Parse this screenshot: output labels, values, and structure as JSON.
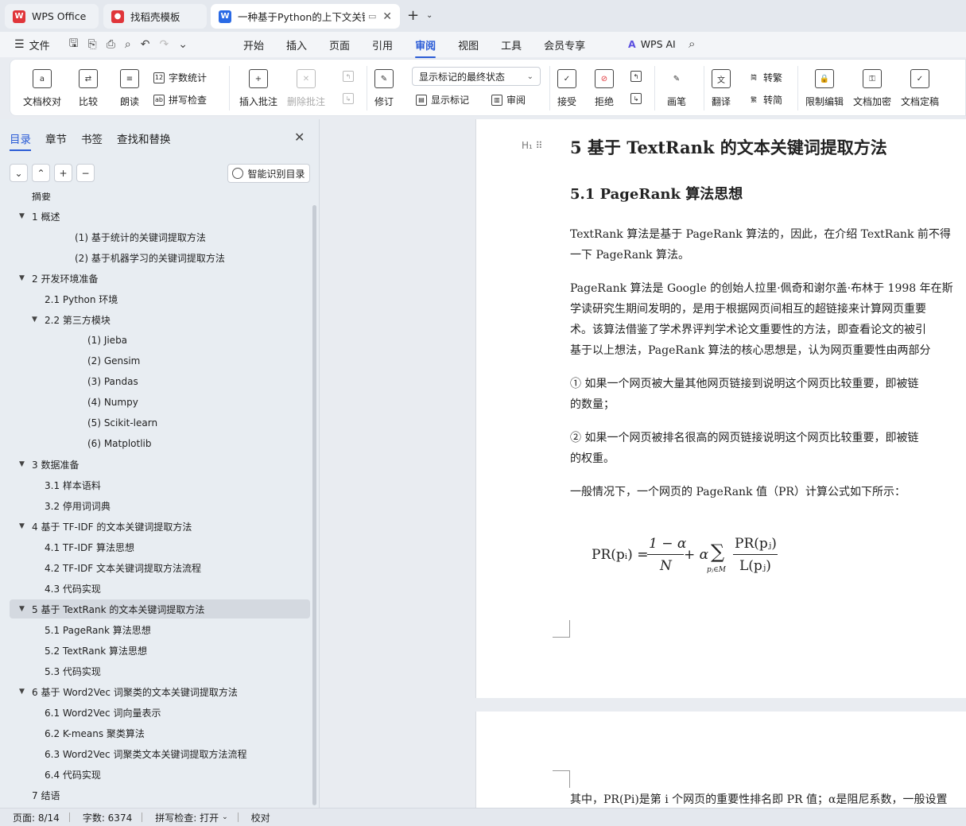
{
  "tabs": {
    "wps": "WPS Office",
    "template": "找稻壳模板",
    "doc": "一种基于Python的上下文关键",
    "new_tab": "+"
  },
  "menubar": {
    "file": "文件",
    "menus": [
      "开始",
      "插入",
      "页面",
      "引用",
      "审阅",
      "视图",
      "工具",
      "会员专享"
    ],
    "active": "审阅",
    "wps_ai": "WPS AI"
  },
  "ribbon": {
    "doc_proof": "文档校对",
    "compare": "比较",
    "read_aloud": "朗读",
    "word_count": "字数统计",
    "spell_check": "拼写检查",
    "insert_comment": "插入批注",
    "delete_comment": "删除批注",
    "track": "修订",
    "markup_select": "显示标记的最终状态",
    "show_markup": "显示标记",
    "review": "审阅",
    "accept": "接受",
    "reject": "拒绝",
    "pen": "画笔",
    "translate": "翻译",
    "to_trad": "转繁",
    "to_simp": "转简",
    "restrict": "限制编辑",
    "encrypt": "文档加密",
    "finalize": "文档定稿"
  },
  "nav": {
    "tabs": [
      "目录",
      "章节",
      "书签",
      "查找和替换"
    ],
    "active_tab": "目录",
    "smart_toc": "智能识别目录",
    "items": [
      {
        "label": "摘要",
        "level": 0
      },
      {
        "label": "1 概述",
        "level": 0,
        "expand": true
      },
      {
        "label": "(1) 基于统计的关键词提取方法",
        "level": 3
      },
      {
        "label": "(2) 基于机器学习的关键词提取方法",
        "level": 3
      },
      {
        "label": "2 开发环境准备",
        "level": 0,
        "expand": true
      },
      {
        "label": "2.1 Python 环境",
        "level": 1
      },
      {
        "label": "2.2 第三方模块",
        "level": 1,
        "expand": true
      },
      {
        "label": "(1) Jieba",
        "level": 4
      },
      {
        "label": "(2) Gensim",
        "level": 4
      },
      {
        "label": "(3) Pandas",
        "level": 4
      },
      {
        "label": "(4) Numpy",
        "level": 4
      },
      {
        "label": "(5) Scikit-learn",
        "level": 4
      },
      {
        "label": "(6) Matplotlib",
        "level": 4
      },
      {
        "label": "3 数据准备",
        "level": 0,
        "expand": true
      },
      {
        "label": "3.1 样本语料",
        "level": 1
      },
      {
        "label": "3.2 停用词词典",
        "level": 1
      },
      {
        "label": "4 基于 TF-IDF 的文本关键词提取方法",
        "level": 0,
        "expand": true
      },
      {
        "label": "4.1 TF-IDF 算法思想",
        "level": 1
      },
      {
        "label": "4.2 TF-IDF 文本关键词提取方法流程",
        "level": 1
      },
      {
        "label": "4.3 代码实现",
        "level": 1
      },
      {
        "label": "5 基于 TextRank 的文本关键词提取方法",
        "level": 0,
        "expand": true,
        "selected": true
      },
      {
        "label": "5.1 PageRank 算法思想",
        "level": 1
      },
      {
        "label": "5.2 TextRank 算法思想",
        "level": 1
      },
      {
        "label": "5.3 代码实现",
        "level": 1
      },
      {
        "label": "6 基于 Word2Vec 词聚类的文本关键词提取方法",
        "level": 0,
        "expand": true
      },
      {
        "label": "6.1 Word2Vec 词向量表示",
        "level": 1
      },
      {
        "label": "6.2 K-means 聚类算法",
        "level": 1
      },
      {
        "label": "6.3 Word2Vec 词聚类文本关键词提取方法流程",
        "level": 1
      },
      {
        "label": "6.4 代码实现",
        "level": 1
      },
      {
        "label": "7 结语",
        "level": 0
      }
    ]
  },
  "document": {
    "heading1": "5 基于 TextRank 的文本关键词提取方法",
    "heading2": "5.1 PageRank 算法思想",
    "p1_l1": "TextRank 算法是基于 PageRank 算法的，因此，在介绍 TextRank 前不得",
    "p1_l2": "一下 PageRank 算法。",
    "p2_l1": "PageRank 算法是 Google 的创始人拉里·佩奇和谢尔盖·布林于 1998 年在斯",
    "p2_l2": "学读研究生期间发明的，是用于根据网页间相互的超链接来计算网页重要",
    "p2_l3": "术。该算法借鉴了学术界评判学术论文重要性的方法，即查看论文的被引",
    "p2_l4": "基于以上想法，PageRank 算法的核心思想是，认为网页重要性由两部分",
    "p3_l1": "① 如果一个网页被大量其他网页链接到说明这个网页比较重要，即被链",
    "p3_l2": "的数量；",
    "p4_l1": "② 如果一个网页被排名很高的网页链接说明这个网页比较重要，即被链",
    "p4_l2": "的权重。",
    "p5": "一般情况下，一个网页的 PageRank 值（PR）计算公式如下所示：",
    "page2_text": "其中，PR(Pi)是第 i 个网页的重要性排名即 PR 值；α是阻尼系数，一般设置"
  },
  "formula": {
    "lhs": "PR(pᵢ) =",
    "num1": "1 − α",
    "den1": "N",
    "plus": "+ α",
    "sum": "∑",
    "sub": "pⱼ∈M",
    "num2": "PR(pⱼ)",
    "den2": "L(pⱼ)"
  },
  "status": {
    "page": "页面: 8/14",
    "words": "字数: 6374",
    "spell": "拼写检查: 打开",
    "proof": "校对"
  },
  "colors": {
    "accent": "#2b5cd6",
    "wps_red": "#e0353a",
    "doc_blue": "#2a6ae5"
  }
}
